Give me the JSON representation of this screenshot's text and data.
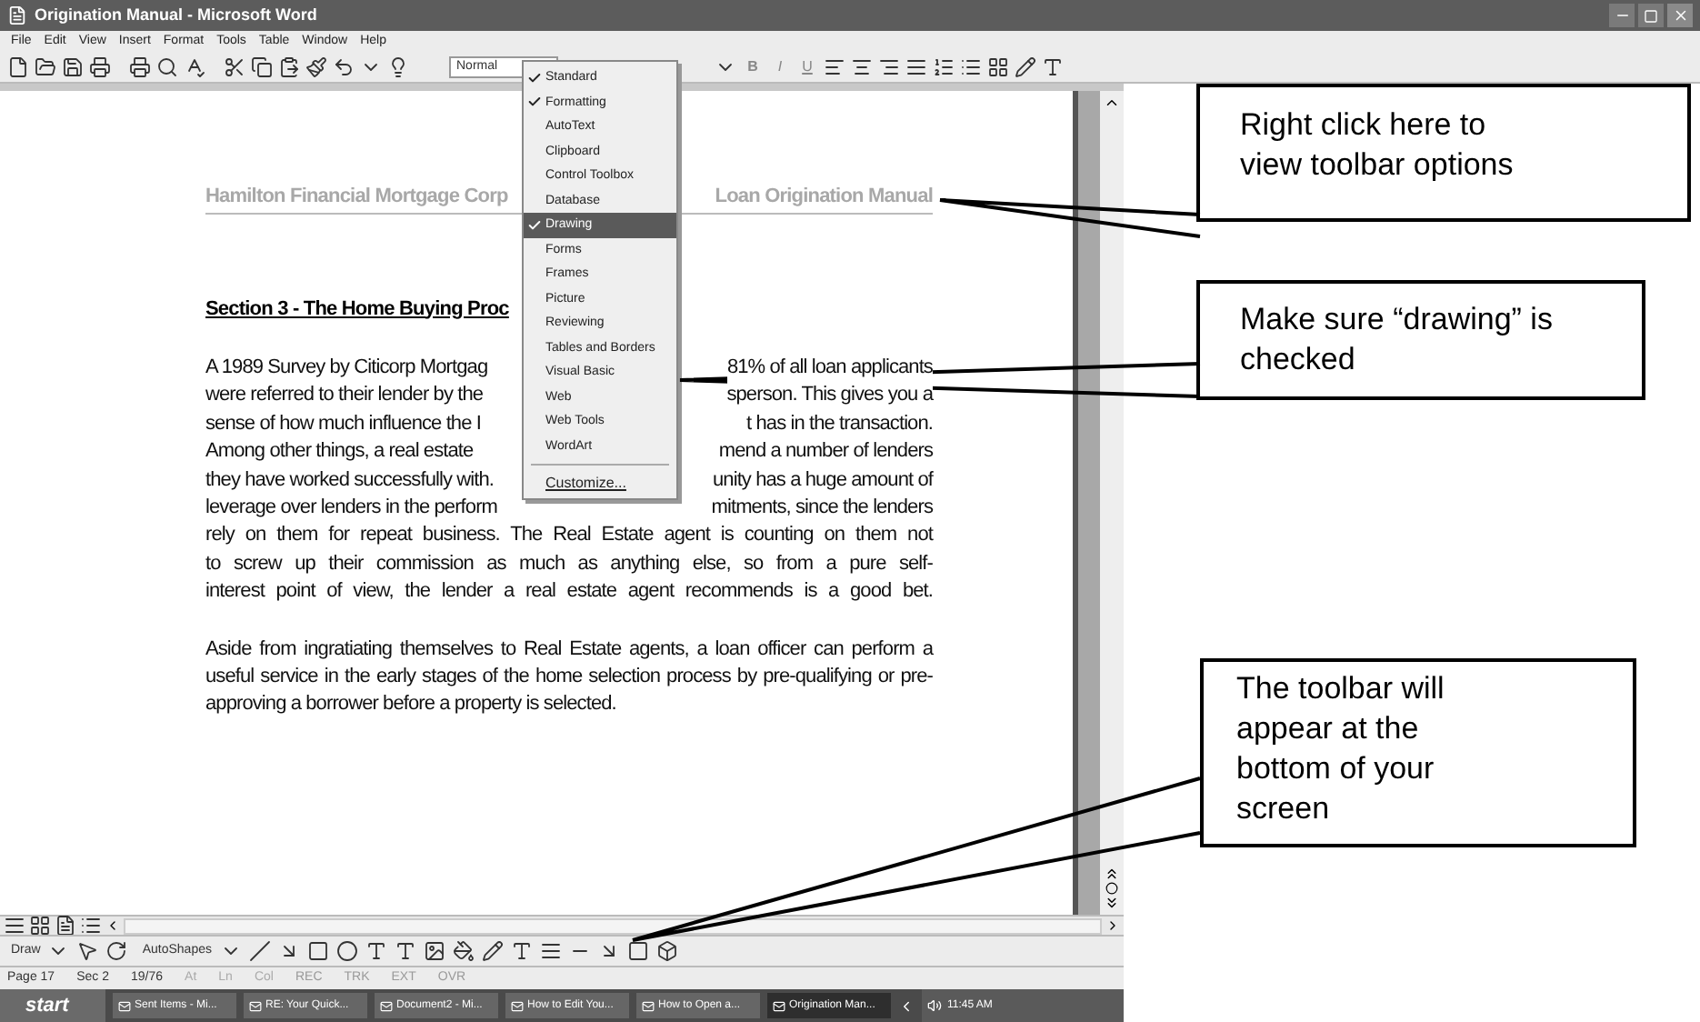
{
  "window": {
    "title": "Origination Manual - Microsoft Word"
  },
  "menu_bar": [
    "File",
    "Edit",
    "View",
    "Insert",
    "Format",
    "Tools",
    "Table",
    "Window",
    "Help"
  ],
  "toolbar": {
    "style": "Normal",
    "formatting_buttons": [
      "B",
      "I",
      "U"
    ]
  },
  "toolbar_menu": {
    "items": [
      {
        "label": "Standard",
        "checked": true,
        "selected": false
      },
      {
        "label": "Formatting",
        "checked": true,
        "selected": false
      },
      {
        "label": "AutoText",
        "checked": false,
        "selected": false
      },
      {
        "label": "Clipboard",
        "checked": false,
        "selected": false
      },
      {
        "label": "Control Toolbox",
        "checked": false,
        "selected": false
      },
      {
        "label": "Database",
        "checked": false,
        "selected": false
      },
      {
        "label": "Drawing",
        "checked": true,
        "selected": true
      },
      {
        "label": "Forms",
        "checked": false,
        "selected": false
      },
      {
        "label": "Frames",
        "checked": false,
        "selected": false
      },
      {
        "label": "Picture",
        "checked": false,
        "selected": false
      },
      {
        "label": "Reviewing",
        "checked": false,
        "selected": false
      },
      {
        "label": "Tables and Borders",
        "checked": false,
        "selected": false
      },
      {
        "label": "Visual Basic",
        "checked": false,
        "selected": false
      },
      {
        "label": "Web",
        "checked": false,
        "selected": false
      },
      {
        "label": "Web Tools",
        "checked": false,
        "selected": false
      },
      {
        "label": "WordArt",
        "checked": false,
        "selected": false
      }
    ],
    "customize": "Customize..."
  },
  "document": {
    "header_left": "Hamilton Financial Mortgage Corp",
    "header_right": "Loan Origination Manual",
    "heading": "Section 3 - The Home Buying Proc",
    "paragraph_1": [
      {
        "left": "A 1989 Survey by Citicorp Mortgag",
        "right": "81% of all loan applicants"
      },
      {
        "left": "were referred to their lender by the",
        "right": "sperson. This gives you a"
      },
      {
        "left": "sense of how much influence the I",
        "right": "t has in the transaction."
      },
      {
        "left": "Among other things, a real estate",
        "right": "mend a number of lenders"
      },
      {
        "left": "they have worked successfully with.",
        "right": "unity has a huge amount of"
      },
      {
        "left": "leverage over lenders in the perform",
        "right": "mitments, since the lenders"
      },
      {
        "text": "rely on them for repeat business. The Real Estate agent is counting on them not"
      },
      {
        "text": "to screw up their commission as much as anything else, so from a pure self-"
      },
      {
        "text": "interest point of view, the lender a real estate agent recommends is a good bet."
      }
    ],
    "paragraph_2": "Aside from ingratiating themselves to Real Estate agents, a loan officer can perform a useful service in the early stages of the home selection process by pre-qualifying or pre-approving a borrower before a property is selected."
  },
  "drawing_toolbar": {
    "draw": "Draw",
    "autoshapes": "AutoShapes"
  },
  "status_bar": [
    "Page 17",
    "Sec 2",
    "19/76",
    "At",
    "Ln",
    "Col",
    "REC",
    "TRK",
    "EXT",
    "OVR"
  ],
  "taskbar": {
    "start": "start",
    "tasks": [
      {
        "label": "Sent Items - Mi...",
        "selected": false
      },
      {
        "label": "RE: Your Quick...",
        "selected": false
      },
      {
        "label": "Document2 - Mi...",
        "selected": false
      },
      {
        "label": "How to Edit You...",
        "selected": false
      },
      {
        "label": "How to Open a...",
        "selected": false
      },
      {
        "label": "Origination Man...",
        "selected": true
      }
    ],
    "clock": "11:45 AM"
  },
  "callouts": [
    {
      "text": "Right click here to view toolbar options"
    },
    {
      "text": "Make sure “drawing” is checked"
    },
    {
      "text": "The toolbar will appear at the bottom of your screen"
    }
  ]
}
